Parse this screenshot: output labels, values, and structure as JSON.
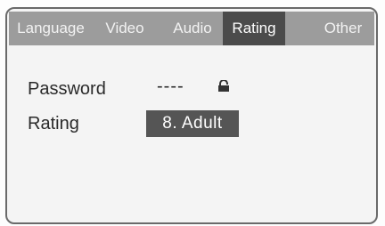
{
  "tabs": [
    {
      "label": "Language"
    },
    {
      "label": "Video"
    },
    {
      "label": "Audio"
    },
    {
      "label": "Rating"
    },
    {
      "label": "Other"
    }
  ],
  "active_tab": "Rating",
  "settings": {
    "password_label": "Password",
    "password_value": "----",
    "rating_label": "Rating",
    "rating_value": "8. Adult"
  },
  "icons": {
    "lock": "lock-icon"
  },
  "colors": {
    "tab_bar": "#9c9c9c",
    "tab_active": "#4b4b4b",
    "selected_value": "#555555"
  }
}
